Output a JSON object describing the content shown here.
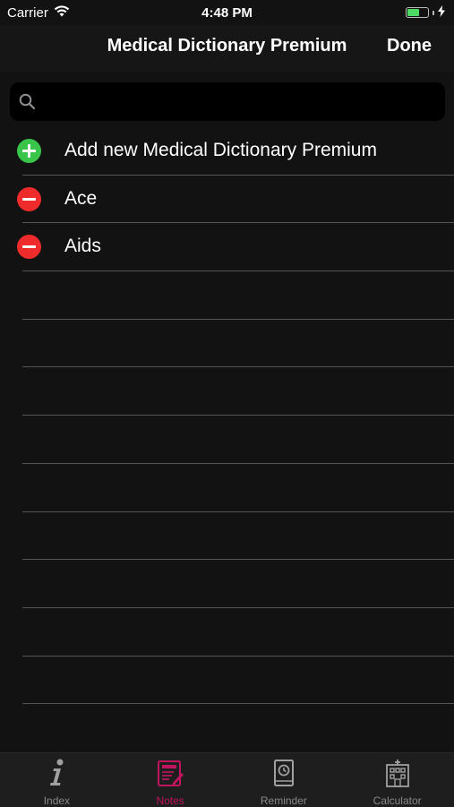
{
  "status_bar": {
    "carrier": "Carrier",
    "time": "4:48 PM"
  },
  "nav": {
    "title": "Medical Dictionary Premium",
    "done_label": "Done"
  },
  "search": {
    "placeholder": ""
  },
  "list": {
    "items": [
      {
        "type": "add",
        "label": "Add new Medical Dictionary Premium"
      },
      {
        "type": "remove",
        "label": "Ace"
      },
      {
        "type": "remove",
        "label": "Aids"
      }
    ]
  },
  "tabs": [
    {
      "label": "Index",
      "icon": "info-icon",
      "active": false
    },
    {
      "label": "Notes",
      "icon": "notes-icon",
      "active": true
    },
    {
      "label": "Reminder",
      "icon": "reminder-icon",
      "active": false
    },
    {
      "label": "Calculator",
      "icon": "calculator-icon",
      "active": false
    }
  ],
  "colors": {
    "active_tab": "#c0145f",
    "add": "#39c54a",
    "remove": "#ef2b2b",
    "battery": "#4cd964"
  }
}
